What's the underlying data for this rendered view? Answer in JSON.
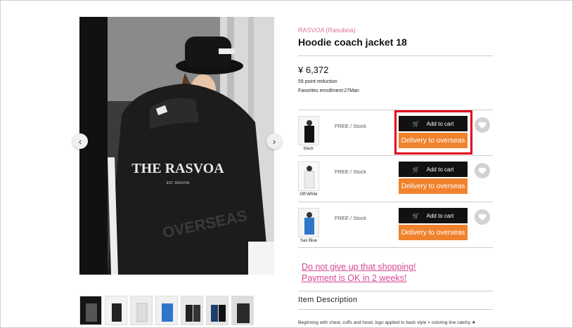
{
  "product": {
    "brand": "RASVOA (Rasuboa)",
    "title": "Hoodie coach jacket 18",
    "price": "¥ 6,372",
    "points": "59 point reduction",
    "favorites": "Favorites enrollment:27Man",
    "jacket_print": "THE RASVOA",
    "jacket_print_small": "EST. RASVOA"
  },
  "variants": [
    {
      "color": "black",
      "stock": "FREE / Stock",
      "cart_label": "Add to cart",
      "delivery_label": "Delivery to overseas",
      "swatch": "#111111"
    },
    {
      "color": "Off-White",
      "stock": "FREE / Stock",
      "cart_label": "Add to cart",
      "delivery_label": "Delivery to overseas",
      "swatch": "#f2f2f2"
    },
    {
      "color": "Sax Blue",
      "stock": "FREE / Stock",
      "cart_label": "Add to cart",
      "delivery_label": "Delivery to overseas",
      "swatch": "#2f76c9"
    }
  ],
  "promo": {
    "line1": "Do not give up that shopping!",
    "line2": "Payment is OK in 2 weeks!"
  },
  "description": {
    "heading": "Item Description",
    "text": "Beginning with chest, cuffs and hood, logo applied to back style × coloring line catchy ★"
  },
  "thumbnails": [
    "#151515",
    "#f3f3f3",
    "#ececec",
    "#2f76c9",
    "#e8e8e8",
    "#1e3f6e",
    "#2a2a2a"
  ],
  "colors": {
    "accent_pink": "#e0719b",
    "promo_pink": "#d64797",
    "orange": "#f0822d",
    "highlight_red": "#e3001b"
  }
}
